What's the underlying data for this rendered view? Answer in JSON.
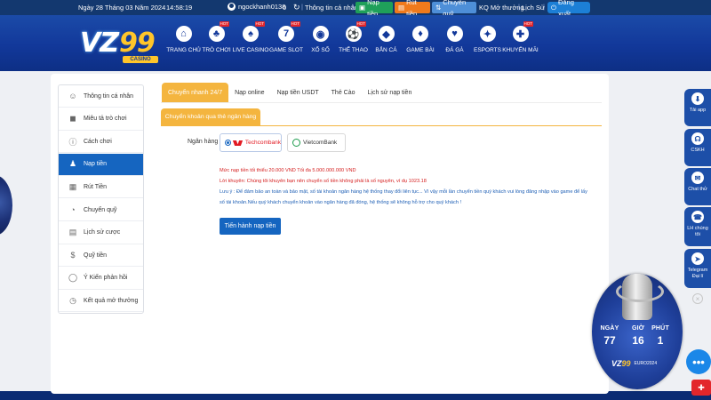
{
  "topbar": {
    "date": "Ngày 28 Tháng 03 Năm 2024",
    "time": "14:58:19",
    "username": "ngockhanh0138",
    "balance": "0",
    "account_link": "Thông tin cá nhân",
    "deposit_btn": "Nạp tiền",
    "withdraw_btn": "Rút tiền",
    "transfer_btn": "Chuyển quỹ",
    "results_link": "KQ Mở thưởng",
    "history_link": "Lịch Sử",
    "logout_btn": "Đăng xuất"
  },
  "logo": {
    "brand_a": "VZ",
    "brand_b": "99",
    "tag": "CASINO"
  },
  "nav": [
    {
      "label": "TRANG CHỦ",
      "icon": "home-icon",
      "glyph": "⌂",
      "hot": false
    },
    {
      "label": "TRÒ CHƠI",
      "icon": "game-icon",
      "glyph": "♣",
      "hot": true
    },
    {
      "label": "LIVE CASINO",
      "icon": "live-casino-icon",
      "glyph": "♠",
      "hot": true
    },
    {
      "label": "GAME SLOT",
      "icon": "slot-icon",
      "glyph": "7",
      "hot": true
    },
    {
      "label": "XỔ SỐ",
      "icon": "lottery-icon",
      "glyph": "◉",
      "hot": false
    },
    {
      "label": "THỂ THAO",
      "icon": "sports-icon",
      "glyph": "⚽",
      "hot": true
    },
    {
      "label": "BẮN CÁ",
      "icon": "fish-icon",
      "glyph": "◆",
      "hot": false
    },
    {
      "label": "GAME BÀI",
      "icon": "cards-icon",
      "glyph": "♦",
      "hot": false
    },
    {
      "label": "ĐÁ GÀ",
      "icon": "rooster-icon",
      "glyph": "♥",
      "hot": false
    },
    {
      "label": "ESPORTS",
      "icon": "esports-icon",
      "glyph": "✦",
      "hot": false
    },
    {
      "label": "KHUYẾN MÃI",
      "icon": "gift-icon",
      "glyph": "✚",
      "hot": true
    }
  ],
  "hot_label": "HOT",
  "sidebar": {
    "items": [
      {
        "label": "Thông tin cá nhân",
        "icon": "user-icon",
        "glyph": "☺"
      },
      {
        "label": "Miêu tả trò chơi",
        "icon": "gamepad-icon",
        "glyph": "◼"
      },
      {
        "label": "Cách chơi",
        "icon": "info-icon",
        "glyph": "ⓘ"
      },
      {
        "label": "Nạp tiền",
        "icon": "deposit-icon",
        "glyph": "♟"
      },
      {
        "label": "Rút Tiền",
        "icon": "bank-icon",
        "glyph": "▦"
      },
      {
        "label": "Chuyển quỹ",
        "icon": "transfer-icon",
        "glyph": "◔"
      },
      {
        "label": "Lịch sử cược",
        "icon": "history-icon",
        "glyph": "▤"
      },
      {
        "label": "Quỹ tiền",
        "icon": "coins-icon",
        "glyph": "$"
      },
      {
        "label": "Ý Kiến phản hồi",
        "icon": "feedback-icon",
        "glyph": "◯"
      },
      {
        "label": "Kết quả mở thưởng",
        "icon": "results-icon",
        "glyph": "◷"
      }
    ],
    "active_index": 3
  },
  "tabs": [
    "Chuyển nhanh 24/7",
    "Nạp online",
    "Nạp tiền USDT",
    "Thẻ Cào",
    "Lịch sử nạp tiền"
  ],
  "subtab": "Chuyển khoản qua thẻ ngân hàng",
  "bank": {
    "label": "Ngân hàng",
    "options": [
      "Techcombank",
      "VietcomBank"
    ],
    "selected": "Techcombank"
  },
  "notes": {
    "limit": "Mức nạp tiền tối thiểu 20.000 VND Tối đa 5.000.000.000 VND",
    "advice": "Lời khuyên: Chúng tôi khuyên bạn nên chuyển số tiền không phải là số nguyên, ví dụ 1023.18",
    "caution": "Lưu ý : Để đảm bảo an toàn và bảo mật, số tài khoản ngân hàng hệ thống thay đổi liên tục... Vì vậy mỗi lần chuyển tiền quý khách vui lòng đăng nhập vào game để lấy số tài khoản.Nếu quý khách chuyển khoản vào ngân hàng đã đóng, hệ thống sẽ không hỗ trợ cho quý khách !"
  },
  "submit_btn": "Tiến hành nạp tiền",
  "floating": {
    "app": "Tải app",
    "cskh": "CSKH",
    "chat": "Chat thử",
    "phone": "LH chúng tôi",
    "telegram": "Telegram Đại lí"
  },
  "countdown": {
    "days_label": "NGÀY",
    "days": "77",
    "hours_label": "GIỜ",
    "hours": "16",
    "mins_label": "PHÚT",
    "mins": "1",
    "event": "EURO2024"
  },
  "colors": {
    "nav_blue": "#12389a",
    "accent_orange": "#f4b53f",
    "primary_blue": "#1565c0",
    "alert_red": "#d51e1e"
  }
}
